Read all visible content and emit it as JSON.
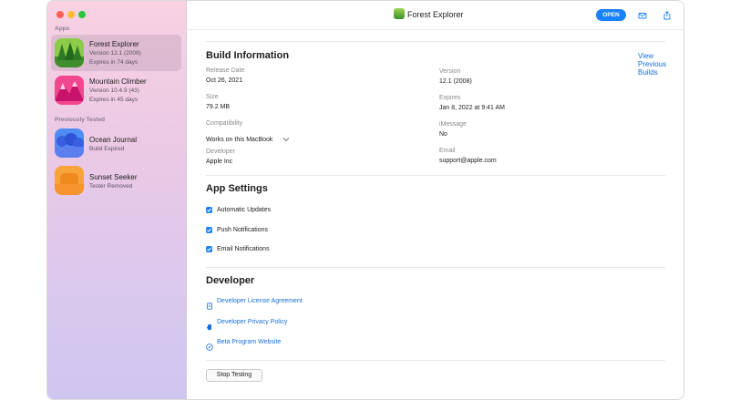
{
  "sidebar": {
    "apps_heading": "Apps",
    "previously_heading": "Previously Tested",
    "apps": [
      {
        "name": "Forest Explorer",
        "version": "Version 12.1 (2008)",
        "status": "Expires in 74 days",
        "icon": "forest-icon",
        "color": "#5fb33a"
      },
      {
        "name": "Mountain Climber",
        "version": "Version 10.4.9 (43)",
        "status": "Expires in 45 days",
        "icon": "mountain-icon",
        "color": "#e8307e"
      }
    ],
    "previous": [
      {
        "name": "Ocean Journal",
        "status": "Build Expired",
        "icon": "ocean-icon",
        "color": "#3d6ee8"
      },
      {
        "name": "Sunset Seeker",
        "status": "Tester Removed",
        "icon": "sunset-icon",
        "color": "#f3962c"
      }
    ]
  },
  "toolbar": {
    "title": "Forest Explorer",
    "open_label": "OPEN",
    "icons": [
      "mail-icon",
      "share-icon"
    ]
  },
  "build_info": {
    "heading": "Build Information",
    "view_previous": "View Previous Builds",
    "release_date_label": "Release Date",
    "release_date": "Oct 26, 2021",
    "version_label": "Version",
    "version": "12.1 (2008)",
    "size_label": "Size",
    "size": "79.2 MB",
    "expires_label": "Expires",
    "expires": "Jan 8, 2022 at 9:41 AM",
    "compatibility_label": "Compatibility",
    "compatibility": "Works on this MacBook",
    "imessage_label": "iMessage",
    "imessage": "No",
    "developer_label": "Developer",
    "developer": "Apple Inc",
    "email_label": "Email",
    "email": "support@apple.com"
  },
  "app_settings": {
    "heading": "App Settings",
    "options": [
      {
        "label": "Automatic Updates",
        "checked": true
      },
      {
        "label": "Push Notifications",
        "checked": true
      },
      {
        "label": "Email Notifications",
        "checked": true
      }
    ]
  },
  "developer": {
    "heading": "Developer",
    "links": [
      {
        "label": "Developer License Agreement",
        "icon": "document-icon"
      },
      {
        "label": "Developer Privacy Policy",
        "icon": "hand-icon"
      },
      {
        "label": "Beta Program Website",
        "icon": "compass-icon"
      }
    ]
  },
  "stop_testing_label": "Stop Testing",
  "colors": {
    "accent": "#1a82fb",
    "link": "#1a6fd6"
  }
}
